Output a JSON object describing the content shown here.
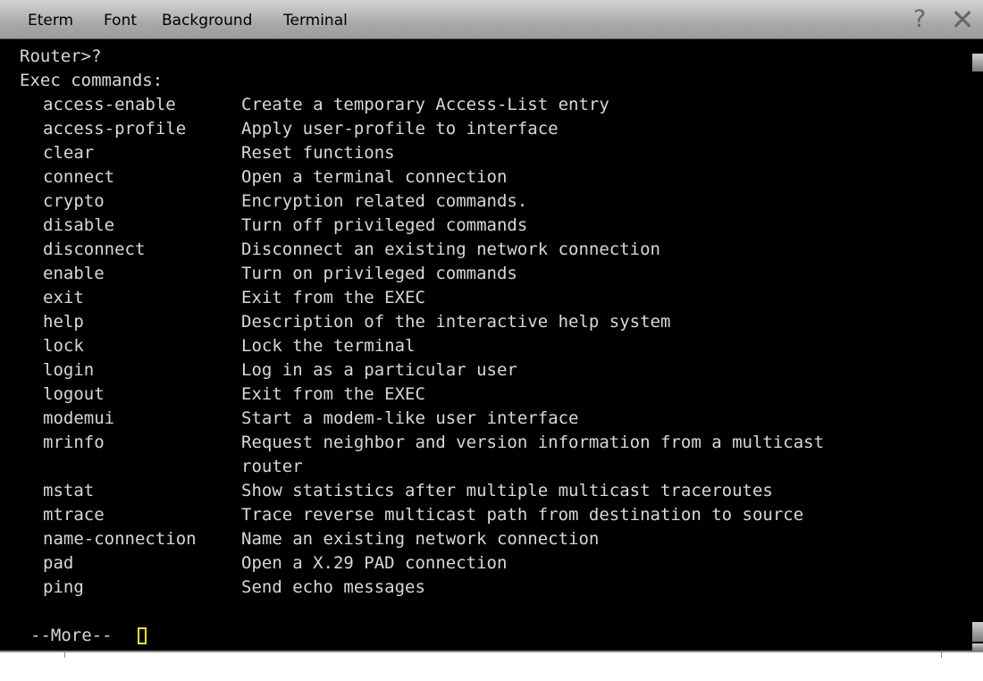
{
  "menubar": {
    "items": [
      "Eterm",
      "Font",
      "Background",
      "Terminal"
    ],
    "help_label": "?",
    "close_label": "✕"
  },
  "terminal": {
    "prompt_line": "Router>?",
    "header_line": "Exec commands:",
    "commands": [
      {
        "name": "access-enable",
        "desc": "Create a temporary Access-List entry"
      },
      {
        "name": "access-profile",
        "desc": "Apply user-profile to interface"
      },
      {
        "name": "clear",
        "desc": "Reset functions"
      },
      {
        "name": "connect",
        "desc": "Open a terminal connection"
      },
      {
        "name": "crypto",
        "desc": "Encryption related commands."
      },
      {
        "name": "disable",
        "desc": "Turn off privileged commands"
      },
      {
        "name": "disconnect",
        "desc": "Disconnect an existing network connection"
      },
      {
        "name": "enable",
        "desc": "Turn on privileged commands"
      },
      {
        "name": "exit",
        "desc": "Exit from the EXEC"
      },
      {
        "name": "help",
        "desc": "Description of the interactive help system"
      },
      {
        "name": "lock",
        "desc": "Lock the terminal"
      },
      {
        "name": "login",
        "desc": "Log in as a particular user"
      },
      {
        "name": "logout",
        "desc": "Exit from the EXEC"
      },
      {
        "name": "modemui",
        "desc": "Start a modem-like user interface"
      },
      {
        "name": "mrinfo",
        "desc": "Request neighbor and version information from a multicast"
      },
      {
        "name": "",
        "desc": "router"
      },
      {
        "name": "mstat",
        "desc": "Show statistics after multiple multicast traceroutes"
      },
      {
        "name": "mtrace",
        "desc": "Trace reverse multicast path from destination to source"
      },
      {
        "name": "name-connection",
        "desc": "Name an existing network connection"
      },
      {
        "name": "pad",
        "desc": "Open a X.29 PAD connection"
      },
      {
        "name": "ping",
        "desc": "Send echo messages"
      }
    ],
    "more_prompt": "--More--",
    "text_color": "#d8d8d8",
    "cursor_color": "#ffe600"
  }
}
